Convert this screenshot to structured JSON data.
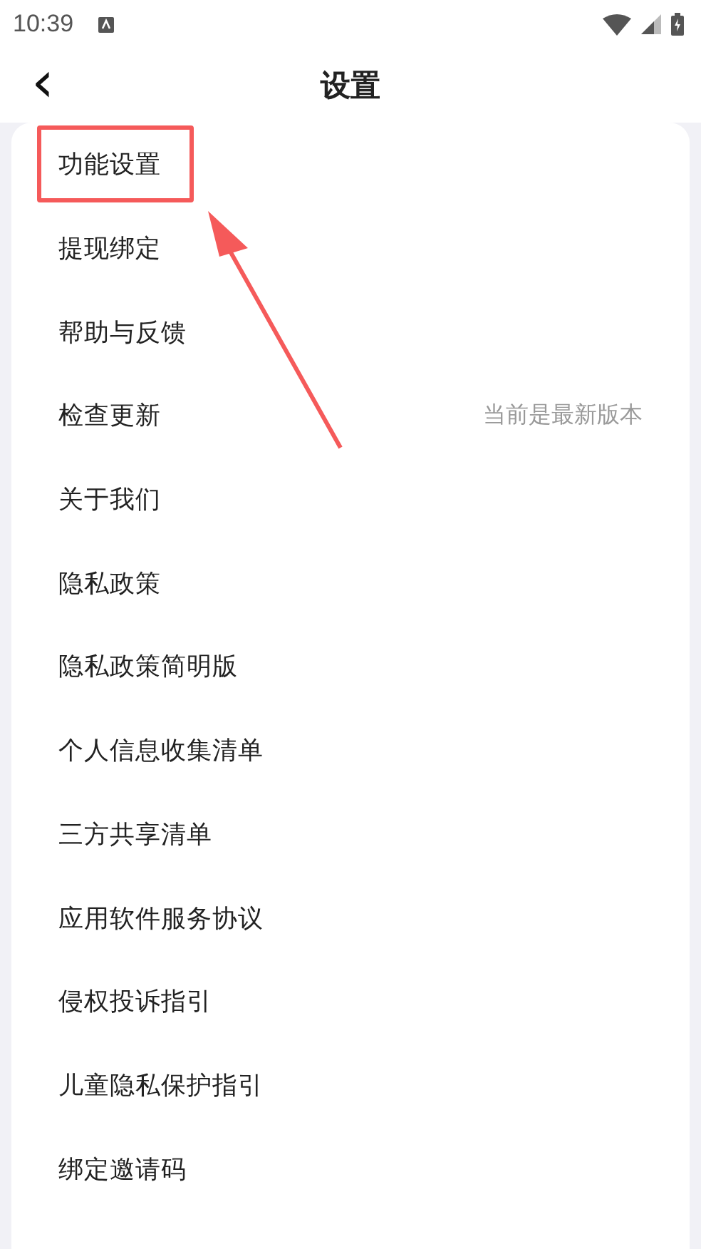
{
  "status_bar": {
    "time": "10:39"
  },
  "header": {
    "back_icon": "‹",
    "title": "设置"
  },
  "items": [
    {
      "label": "功能设置",
      "highlighted": true
    },
    {
      "label": "提现绑定",
      "highlighted": false
    },
    {
      "label": "帮助与反馈",
      "highlighted": false
    },
    {
      "label": "检查更新",
      "value": "当前是最新版本",
      "highlighted": false
    },
    {
      "label": "关于我们",
      "highlighted": false
    },
    {
      "label": "隐私政策",
      "highlighted": false
    },
    {
      "label": "隐私政策简明版",
      "highlighted": false
    },
    {
      "label": "个人信息收集清单",
      "highlighted": false
    },
    {
      "label": "三方共享清单",
      "highlighted": false
    },
    {
      "label": "应用软件服务协议",
      "highlighted": false
    },
    {
      "label": "侵权投诉指引",
      "highlighted": false
    },
    {
      "label": "儿童隐私保护指引",
      "highlighted": false
    },
    {
      "label": "绑定邀请码",
      "highlighted": false
    }
  ]
}
